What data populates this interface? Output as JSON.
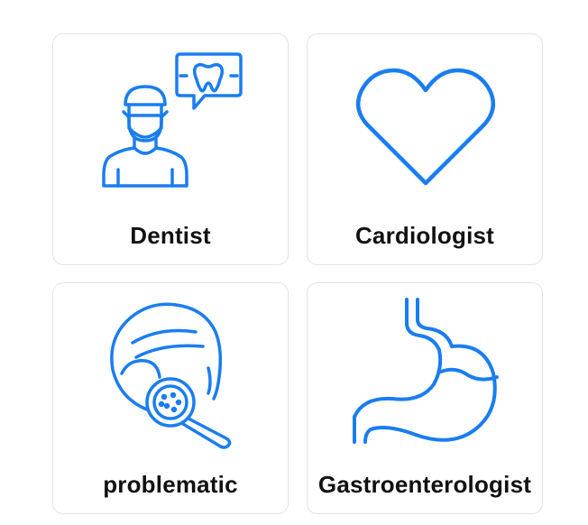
{
  "accent_color": "#1a7df0",
  "cards": [
    {
      "label": "Dentist",
      "icon": "dentist-icon"
    },
    {
      "label": "Cardiologist",
      "icon": "heart-icon"
    },
    {
      "label": "problematic",
      "icon": "skin-inspection-icon"
    },
    {
      "label": "Gastroenterologist",
      "icon": "stomach-icon"
    }
  ]
}
